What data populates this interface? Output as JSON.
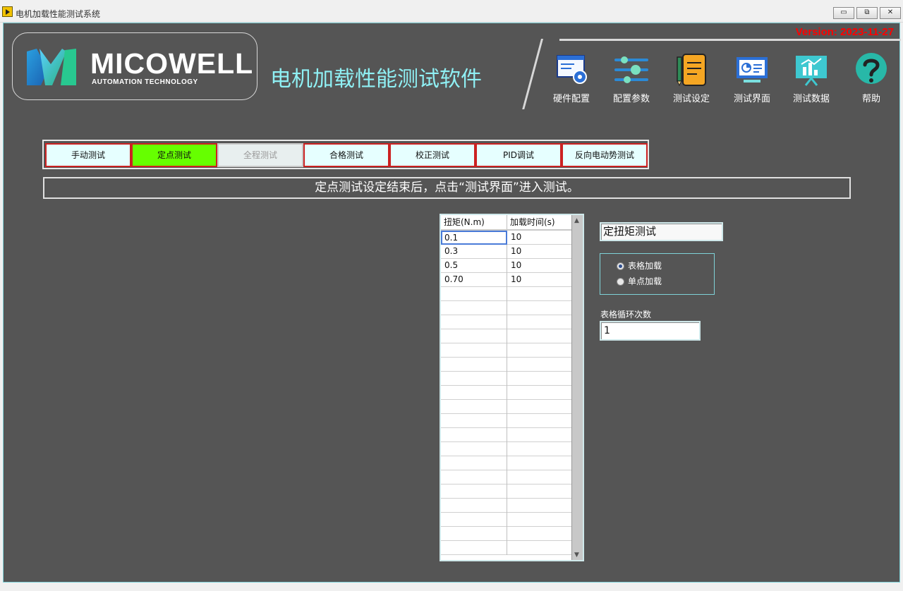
{
  "window": {
    "title": "电机加载性能测试系统",
    "minimize_glyph": "▭",
    "restore_glyph": "⧉",
    "close_glyph": "✕"
  },
  "header": {
    "logo_name": "MICOWELL",
    "logo_sub": "AUTOMATION TECHNOLOGY",
    "app_title": "电机加载性能测试软件",
    "version": "Version: 2023-11-27"
  },
  "nav": [
    {
      "label": "硬件配置",
      "icon": "hardware-config-icon"
    },
    {
      "label": "配置参数",
      "icon": "sliders-icon"
    },
    {
      "label": "测试设定",
      "icon": "notepad-icon"
    },
    {
      "label": "测试界面",
      "icon": "monitor-chart-icon"
    },
    {
      "label": "测试数据",
      "icon": "data-board-icon"
    },
    {
      "label": "帮助",
      "icon": "help-icon"
    }
  ],
  "tabs": [
    {
      "label": "手动测试",
      "state": "normal"
    },
    {
      "label": "定点测试",
      "state": "active"
    },
    {
      "label": "全程测试",
      "state": "disabled"
    },
    {
      "label": "合格测试",
      "state": "normal"
    },
    {
      "label": "校正测试",
      "state": "normal"
    },
    {
      "label": "PID调试",
      "state": "normal"
    },
    {
      "label": "反向电动势测试",
      "state": "normal"
    }
  ],
  "info_message": "定点测试设定结束后，点击“测试界面”进入测试。",
  "table": {
    "headers": [
      "扭矩(N.m)",
      "加载时间(s)"
    ],
    "rows": [
      [
        "0.1",
        "10"
      ],
      [
        "0.3",
        "10"
      ],
      [
        "0.5",
        "10"
      ],
      [
        "0.70",
        "10"
      ],
      [
        "",
        ""
      ],
      [
        "",
        ""
      ],
      [
        "",
        ""
      ],
      [
        "",
        ""
      ],
      [
        "",
        ""
      ],
      [
        "",
        ""
      ],
      [
        "",
        ""
      ],
      [
        "",
        ""
      ],
      [
        "",
        ""
      ],
      [
        "",
        ""
      ],
      [
        "",
        ""
      ],
      [
        "",
        ""
      ],
      [
        "",
        ""
      ],
      [
        "",
        ""
      ],
      [
        "",
        ""
      ],
      [
        "",
        ""
      ],
      [
        "",
        ""
      ],
      [
        "",
        ""
      ],
      [
        "",
        ""
      ]
    ],
    "scroll_up": "▲",
    "scroll_down": "▼"
  },
  "controls": {
    "mode_value": "定扭矩测试",
    "load_modes": [
      {
        "label": "表格加载",
        "selected": true
      },
      {
        "label": "单点加载",
        "selected": false
      }
    ],
    "loop_label": "表格循环次数",
    "loop_value": "1"
  },
  "colors": {
    "background": "#555555",
    "accent_cyan": "#8ff0f4",
    "tab_active": "#66ff00",
    "tab_border": "#cc2222",
    "version_red": "#ff0000"
  }
}
